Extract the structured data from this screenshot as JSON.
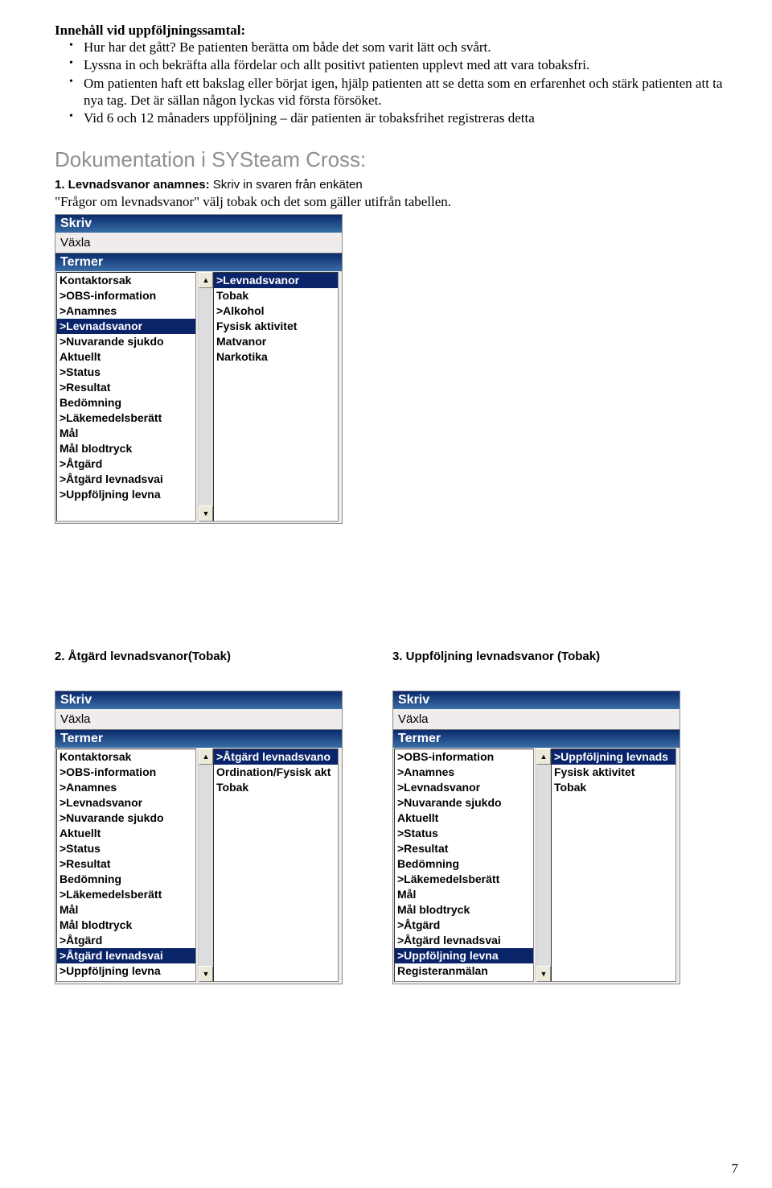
{
  "section_title": "Innehåll vid uppföljningssamtal:",
  "bullets": [
    "Hur har det gått? Be patienten berätta om både det som varit lätt och svårt.",
    "Lyssna in och bekräfta alla fördelar och allt positivt patienten upplevt med att vara tobaksfri.",
    "Om patienten haft ett bakslag eller börjat igen, hjälp patienten att se detta som en erfarenhet och stärk patienten att ta nya tag. Det är sällan någon lyckas vid första försöket.",
    "Vid 6 och 12 månaders uppföljning – där patienten är tobaksfrihet registreras detta"
  ],
  "doc_heading": "Dokumentation i SYSteam Cross:",
  "step1": {
    "lead": "1. Levnadsvanor anamnes:",
    "rest": " Skriv in svaren från enkäten",
    "line2": "\"Frågor om levnadsvanor\" välj tobak och det som gäller utifrån tabellen."
  },
  "panel_labels": {
    "title": "Skriv",
    "sub": "Växla",
    "header": "Termer"
  },
  "panel1": {
    "left_items": [
      {
        "t": "Kontaktorsak"
      },
      {
        "t": ">OBS-information"
      },
      {
        "t": ">Anamnes"
      },
      {
        "t": ">Levnadsvanor",
        "sel": true
      },
      {
        "t": ">Nuvarande sjukdo"
      },
      {
        "t": "Aktuellt"
      },
      {
        "t": ">Status"
      },
      {
        "t": ">Resultat"
      },
      {
        "t": "Bedömning"
      },
      {
        "t": ">Läkemedelsberätt"
      },
      {
        "t": "Mål"
      },
      {
        "t": "Mål blodtryck"
      },
      {
        "t": ">Åtgärd"
      },
      {
        "t": ">Åtgärd levnadsvai"
      },
      {
        "t": ">Uppföljning levna"
      }
    ],
    "right_items": [
      {
        "t": ">Levnadsvanor",
        "sel": true
      },
      {
        "t": "Tobak"
      },
      {
        "t": ">Alkohol"
      },
      {
        "t": "Fysisk aktivitet"
      },
      {
        "t": "Matvanor"
      },
      {
        "t": "Narkotika"
      }
    ]
  },
  "step2": "2. Åtgärd levnadsvanor(Tobak)",
  "step3": "3. Uppföljning levnadsvanor (Tobak)",
  "panel2": {
    "left_items": [
      {
        "t": "Kontaktorsak"
      },
      {
        "t": ">OBS-information"
      },
      {
        "t": ">Anamnes"
      },
      {
        "t": ">Levnadsvanor"
      },
      {
        "t": ">Nuvarande sjukdo"
      },
      {
        "t": "Aktuellt"
      },
      {
        "t": ">Status"
      },
      {
        "t": ">Resultat"
      },
      {
        "t": "Bedömning"
      },
      {
        "t": ">Läkemedelsberätt"
      },
      {
        "t": "Mål"
      },
      {
        "t": "Mål blodtryck"
      },
      {
        "t": ">Åtgärd"
      },
      {
        "t": ">Åtgärd levnadsvai",
        "sel": true
      },
      {
        "t": ">Uppföljning levna"
      }
    ],
    "right_items": [
      {
        "t": ">Åtgärd levnadsvano",
        "sel": true
      },
      {
        "t": "Ordination/Fysisk akt"
      },
      {
        "t": "Tobak"
      }
    ]
  },
  "panel3": {
    "left_items": [
      {
        "t": ">OBS-information"
      },
      {
        "t": ">Anamnes"
      },
      {
        "t": ">Levnadsvanor"
      },
      {
        "t": ">Nuvarande sjukdo"
      },
      {
        "t": "Aktuellt"
      },
      {
        "t": ">Status"
      },
      {
        "t": ">Resultat"
      },
      {
        "t": "Bedömning"
      },
      {
        "t": ">Läkemedelsberätt"
      },
      {
        "t": "Mål"
      },
      {
        "t": "Mål blodtryck"
      },
      {
        "t": ">Åtgärd"
      },
      {
        "t": ">Åtgärd levnadsvai"
      },
      {
        "t": ">Uppföljning levna",
        "sel": true
      },
      {
        "t": "Registeranmälan"
      }
    ],
    "right_items": [
      {
        "t": ">Uppföljning levnads",
        "sel": true
      },
      {
        "t": "Fysisk aktivitet"
      },
      {
        "t": "Tobak"
      }
    ]
  },
  "page_number": "7"
}
